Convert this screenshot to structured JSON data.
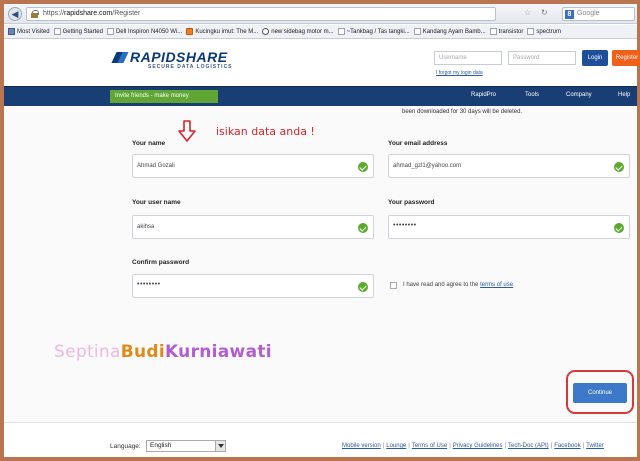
{
  "browser": {
    "url_prefix": "https://",
    "url_host": "rapidshare.com",
    "url_path": "/Register",
    "search_placeholder": "Google",
    "bookmarks": [
      {
        "label": "Most Visited",
        "icon": "mv"
      },
      {
        "label": "Getting Started",
        "icon": "page"
      },
      {
        "label": "Dell Inspiron N4050 Wi...",
        "icon": "page"
      },
      {
        "label": "Kucingku imut: The M...",
        "icon": "bl"
      },
      {
        "label": "new sidebag motor m...",
        "icon": "ci"
      },
      {
        "label": "~Tankbag / Tas tangki...",
        "icon": "page"
      },
      {
        "label": "Kandang Ayam Bamb...",
        "icon": "page"
      },
      {
        "label": "transistor",
        "icon": "page"
      },
      {
        "label": "spectrum",
        "icon": "page"
      }
    ]
  },
  "header": {
    "logo_name": "RAPIDSHARE",
    "logo_sub": "SECURE DATA LOGISTICS",
    "username_placeholder": "Username",
    "password_placeholder": "Password",
    "forgot_link": "I forgot my login data",
    "login_label": "Login",
    "register_label": "Register"
  },
  "nav": {
    "invite_label": "Invite friends - make money",
    "items": [
      "RapidPro",
      "Tools",
      "Company",
      "Help"
    ]
  },
  "form": {
    "notice": "been downloaded for 30 days will be deleted.",
    "annotation": "isikan data anda !",
    "your_name_label": "Your name",
    "your_name_value": "Ahmad Gozali",
    "email_label": "Your email address",
    "email_value": "ahmad_gzl1@yahoo.com",
    "username_label": "Your user name",
    "username_value": "akihsa",
    "password_label": "Your password",
    "password_value": "••••••••",
    "confirm_label": "Confirm password",
    "confirm_value": "••••••••",
    "agree_text": "I have read and agree to the ",
    "terms_link": "terms of use",
    "continue_label": "Continue"
  },
  "watermark": {
    "part1": "Septina",
    "part2": "Budi",
    "part3": "Kurniawati"
  },
  "footer": {
    "language_label": "Language:",
    "language_value": "English",
    "links": [
      "Mobile version",
      "Lounge",
      "Terms of Use",
      "Privacy Guidelines",
      "Tech-Doc (API)",
      "Facebook",
      "Twitter"
    ]
  },
  "colors": {
    "brand_blue": "#183e73",
    "accent_green": "#5fa634",
    "register_orange": "#f06018",
    "annotation_red": "#d6252a"
  }
}
